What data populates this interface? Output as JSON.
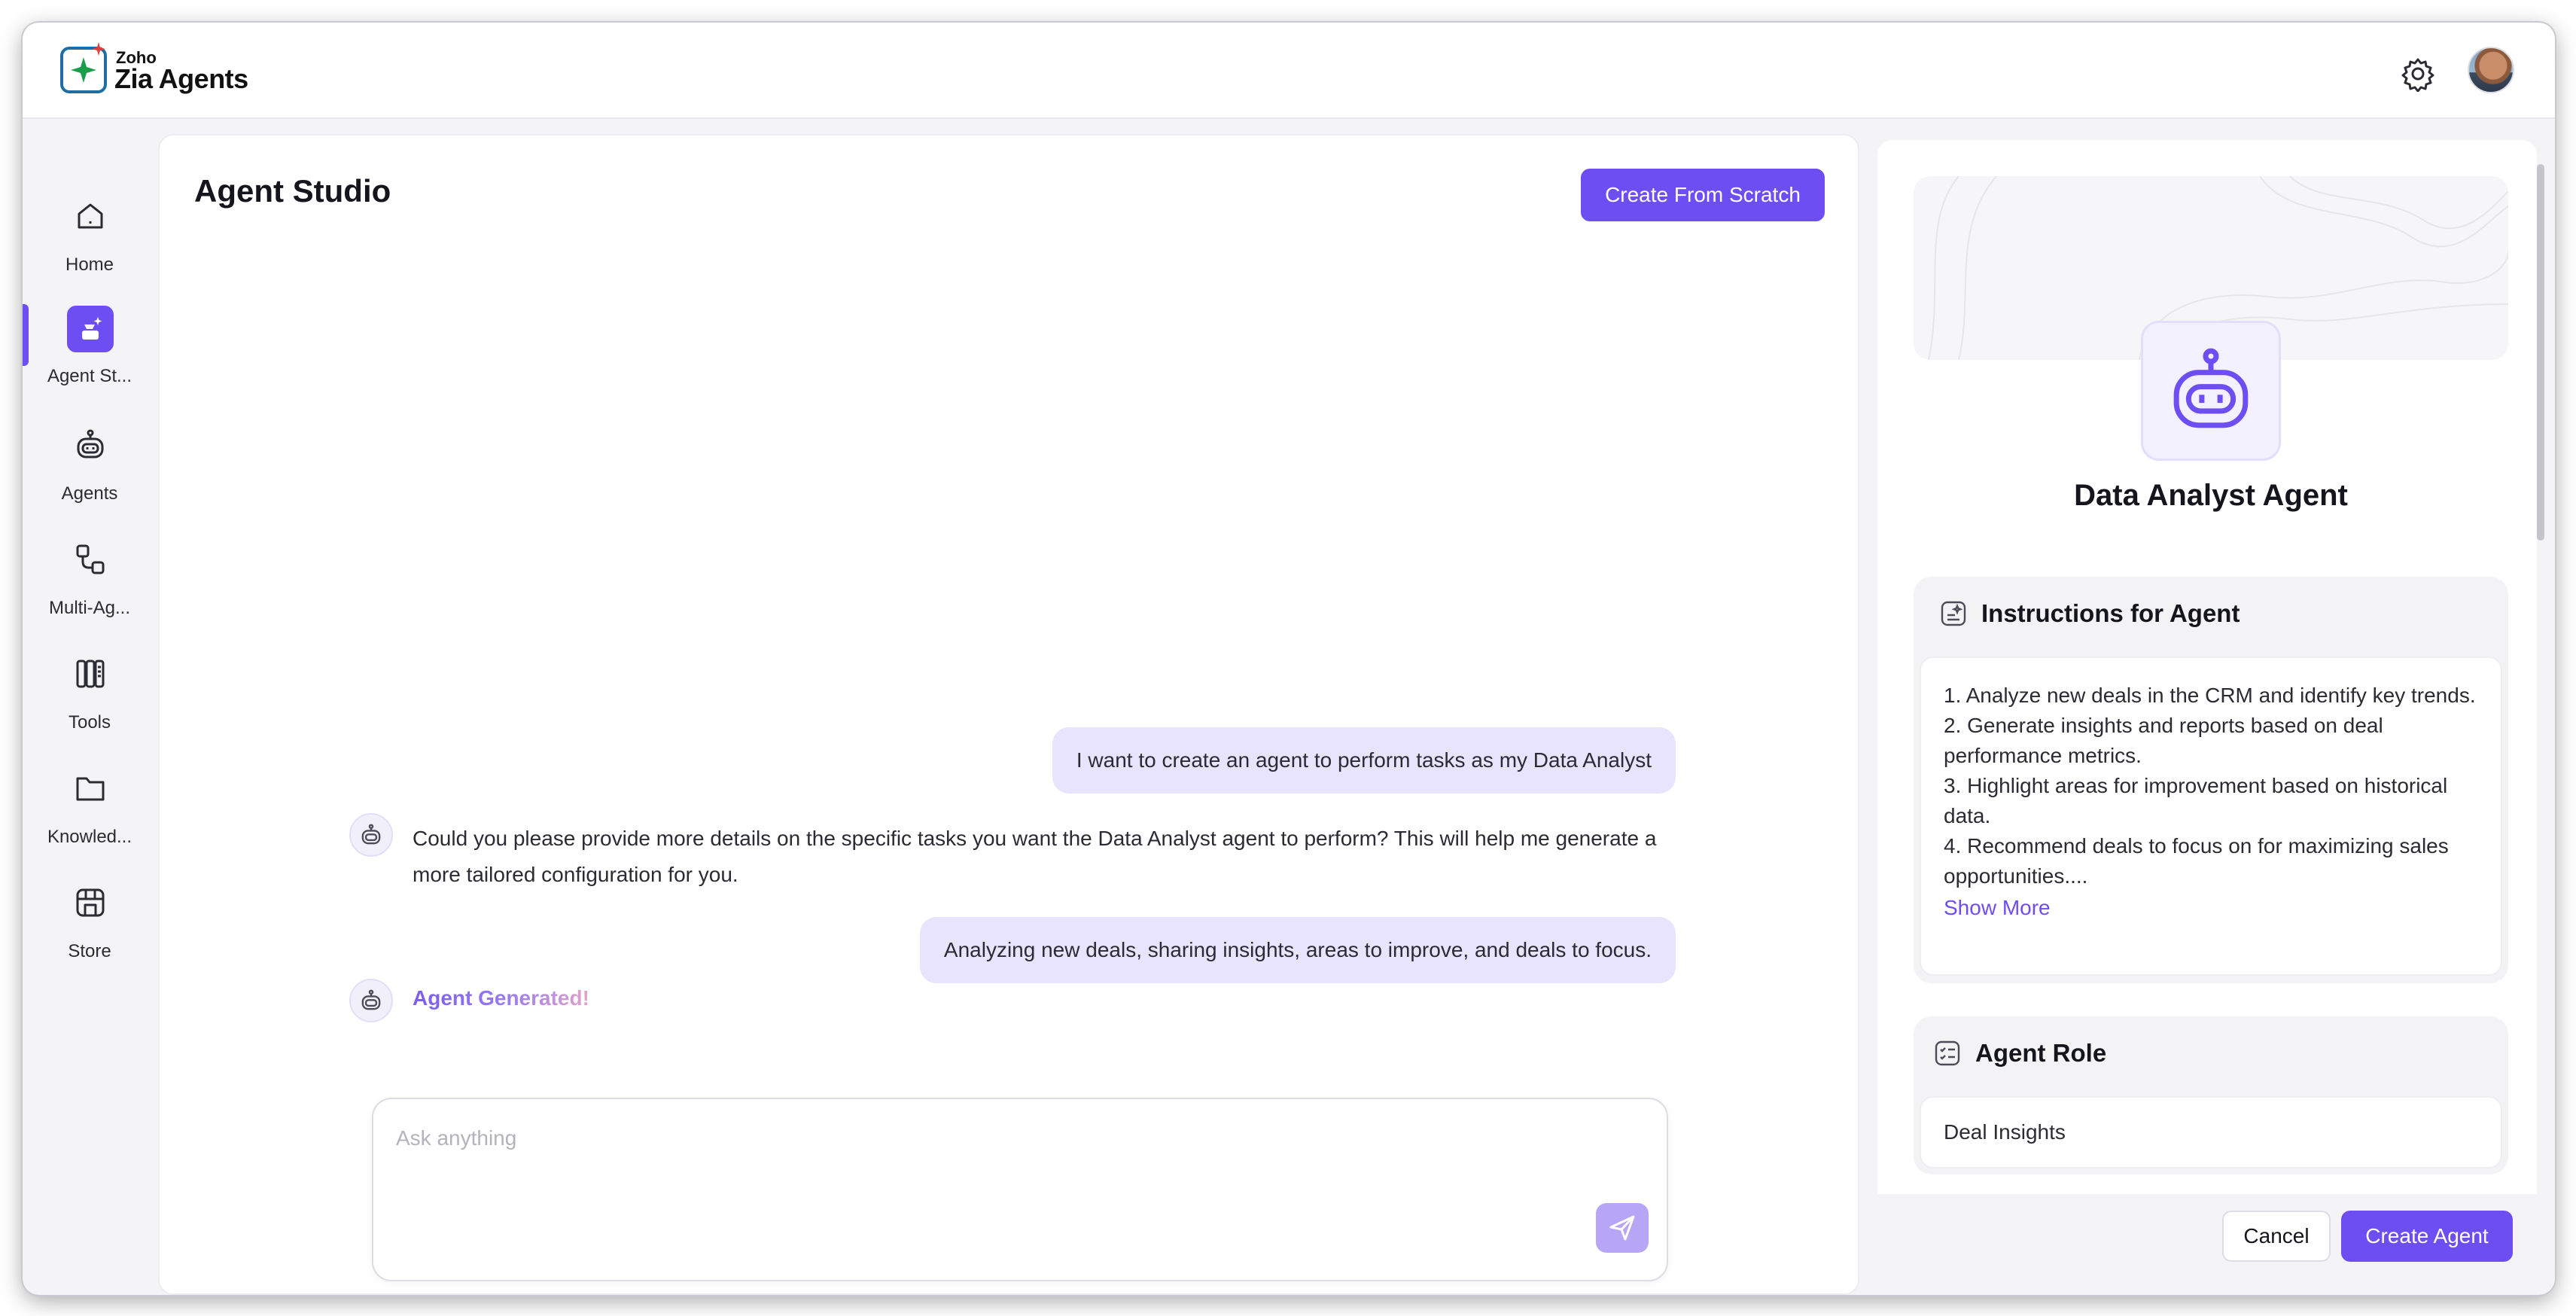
{
  "brand": {
    "small": "Zoho",
    "name": "Zia Agents"
  },
  "sidebar": {
    "items": [
      {
        "label": "Home",
        "icon": "home-icon"
      },
      {
        "label": "Agent St...",
        "icon": "agent-studio-icon",
        "active": true
      },
      {
        "label": "Agents",
        "icon": "robot-icon"
      },
      {
        "label": "Multi-Ag...",
        "icon": "multi-agent-icon"
      },
      {
        "label": "Tools",
        "icon": "tools-icon"
      },
      {
        "label": "Knowled...",
        "icon": "folder-icon"
      },
      {
        "label": "Store",
        "icon": "store-icon"
      }
    ]
  },
  "main": {
    "title": "Agent Studio",
    "create_scratch_label": "Create From Scratch",
    "chat": {
      "user_msg_1": "I want to create an agent to perform tasks as my Data Analyst",
      "bot_msg_1": "Could you please provide more details on the specific tasks you want the Data Analyst agent to perform? This will help me generate a more tailored configuration for you.",
      "user_msg_2": "Analyzing new deals, sharing insights, areas to improve, and deals to focus.",
      "bot_status": "Agent Generated!"
    },
    "composer": {
      "placeholder": "Ask anything"
    }
  },
  "panel": {
    "agent_name": "Data Analyst Agent",
    "instructions": {
      "title": "Instructions for Agent",
      "lines": [
        "1. Analyze new deals in the CRM and identify key trends.",
        "2. Generate insights and reports based on deal performance metrics.",
        "3. Highlight areas for improvement based on historical data.",
        "4. Recommend deals to focus on for maximizing sales opportunities...."
      ],
      "show_more": "Show More"
    },
    "role": {
      "title": "Agent Role",
      "value": "Deal Insights"
    },
    "cancel_label": "Cancel",
    "create_label": "Create Agent"
  },
  "colors": {
    "accent": "#6d4ef2",
    "bubble": "#e9e4fd",
    "background": "#f4f4f7"
  }
}
